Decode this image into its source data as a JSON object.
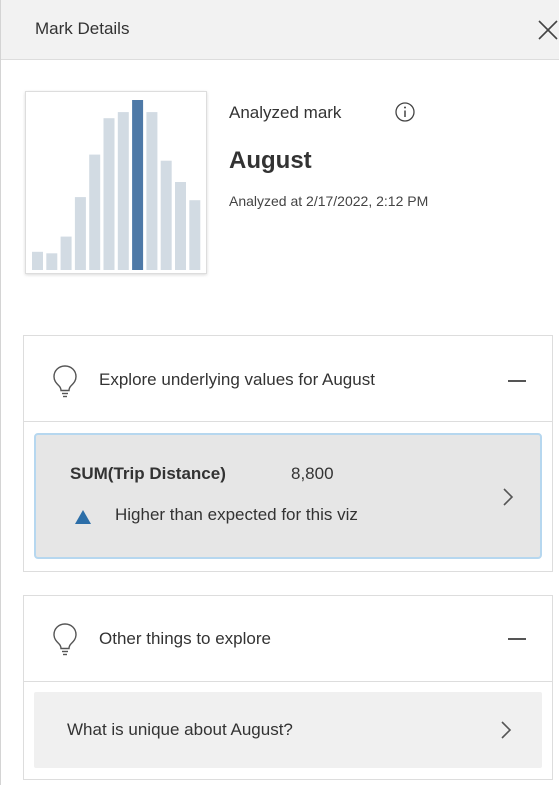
{
  "header": {
    "title": "Mark Details"
  },
  "summary": {
    "analyzed_label": "Analyzed mark",
    "mark_value": "August",
    "analyzed_time": "Analyzed at 2/17/2022, 2:12 PM"
  },
  "thumbnail": {
    "colors": {
      "bar": "#d2dbe3",
      "highlight": "#4e79a7"
    },
    "values": [
      12,
      11,
      22,
      48,
      76,
      100,
      104,
      112,
      104,
      72,
      58,
      46
    ],
    "highlight_index": 7
  },
  "underlying": {
    "title": "Explore underlying values for August",
    "measure_label": "SUM(Trip Distance)",
    "measure_value": "8,800",
    "insight": "Higher than expected for this viz"
  },
  "other": {
    "title": "Other things to explore",
    "question": "What is unique about August?"
  },
  "icons": {
    "close": "close-icon",
    "info": "info-icon",
    "bulb": "lightbulb-icon",
    "collapse": "minus-icon",
    "up": "triangle-up-icon",
    "chevron": "chevron-right-icon"
  }
}
